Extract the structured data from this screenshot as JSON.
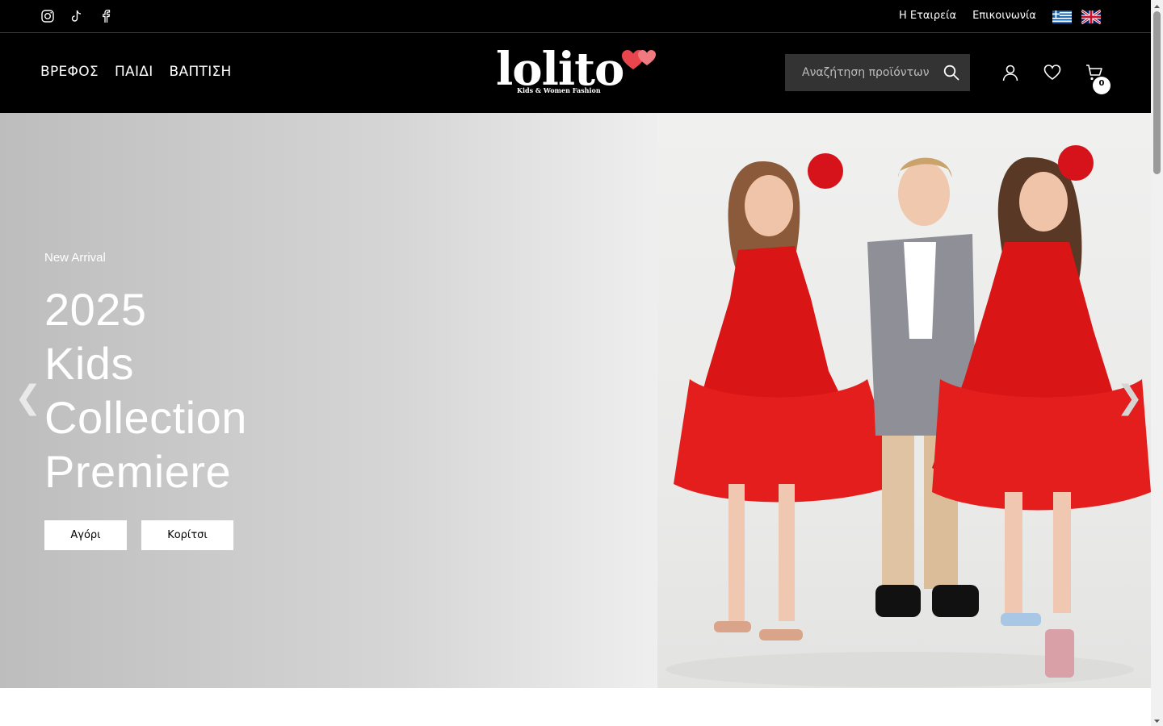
{
  "topbar": {
    "social": [
      {
        "icon": "instagram-icon"
      },
      {
        "icon": "tiktok-icon"
      },
      {
        "icon": "facebook-icon"
      }
    ],
    "links": [
      "Η Εταιρεία",
      "Επικοινωνία"
    ],
    "languages": [
      {
        "icon": "greek-flag-icon"
      },
      {
        "icon": "uk-flag-icon"
      }
    ]
  },
  "header": {
    "nav": [
      "ΒΡΕΦΟΣ",
      "ΠΑΙΔΙ",
      "ΒΑΠΤΙΣΗ"
    ],
    "logo": {
      "text": "lolito",
      "subtitle": "Kids & Women Fashion"
    },
    "search": {
      "placeholder": "Αναζήτηση προϊόντων"
    },
    "cart_count": "0"
  },
  "hero": {
    "eyebrow": "New Arrival",
    "headline": [
      "2025",
      "Kids",
      "Collection",
      "Premiere"
    ],
    "buttons": [
      "Αγόρι",
      "Κορίτσι"
    ],
    "prev_arrow": "❮",
    "next_arrow": "❯"
  },
  "colors": {
    "header_bg": "#000000",
    "search_bg": "#333333",
    "dress_red": "#d91515"
  }
}
